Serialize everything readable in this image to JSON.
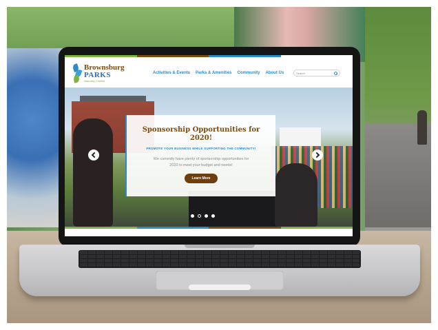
{
  "site": {
    "logo": {
      "line1": "Brownsburg",
      "line2": "PARKS",
      "line3": "Naturally Crafted"
    },
    "nav": {
      "items": [
        {
          "label": "Activities & Events"
        },
        {
          "label": "Parks & Amenities"
        },
        {
          "label": "Community"
        },
        {
          "label": "About Us"
        }
      ]
    },
    "search": {
      "placeholder": "Search"
    },
    "hero": {
      "title": "Sponsorship Opportunities for 2020!",
      "subtitle": "PROMOTE YOUR BUSINESS WHILE SUPPORTING THE COMMUNITY!",
      "text": "We currently have plenty of sponsorship opportunities for 2020 to meet your budget and needs!",
      "button_label": "Learn More",
      "slides_count": 4,
      "active_slide": 1
    },
    "colors": {
      "brand_blue": "#2c8ac6",
      "brand_brown": "#7a4b12",
      "brand_green": "#7cb342",
      "button_brown": "#6b3f10"
    },
    "icons": {
      "prev": "chevron-left-icon",
      "next": "chevron-right-icon",
      "search": "search-icon"
    }
  }
}
